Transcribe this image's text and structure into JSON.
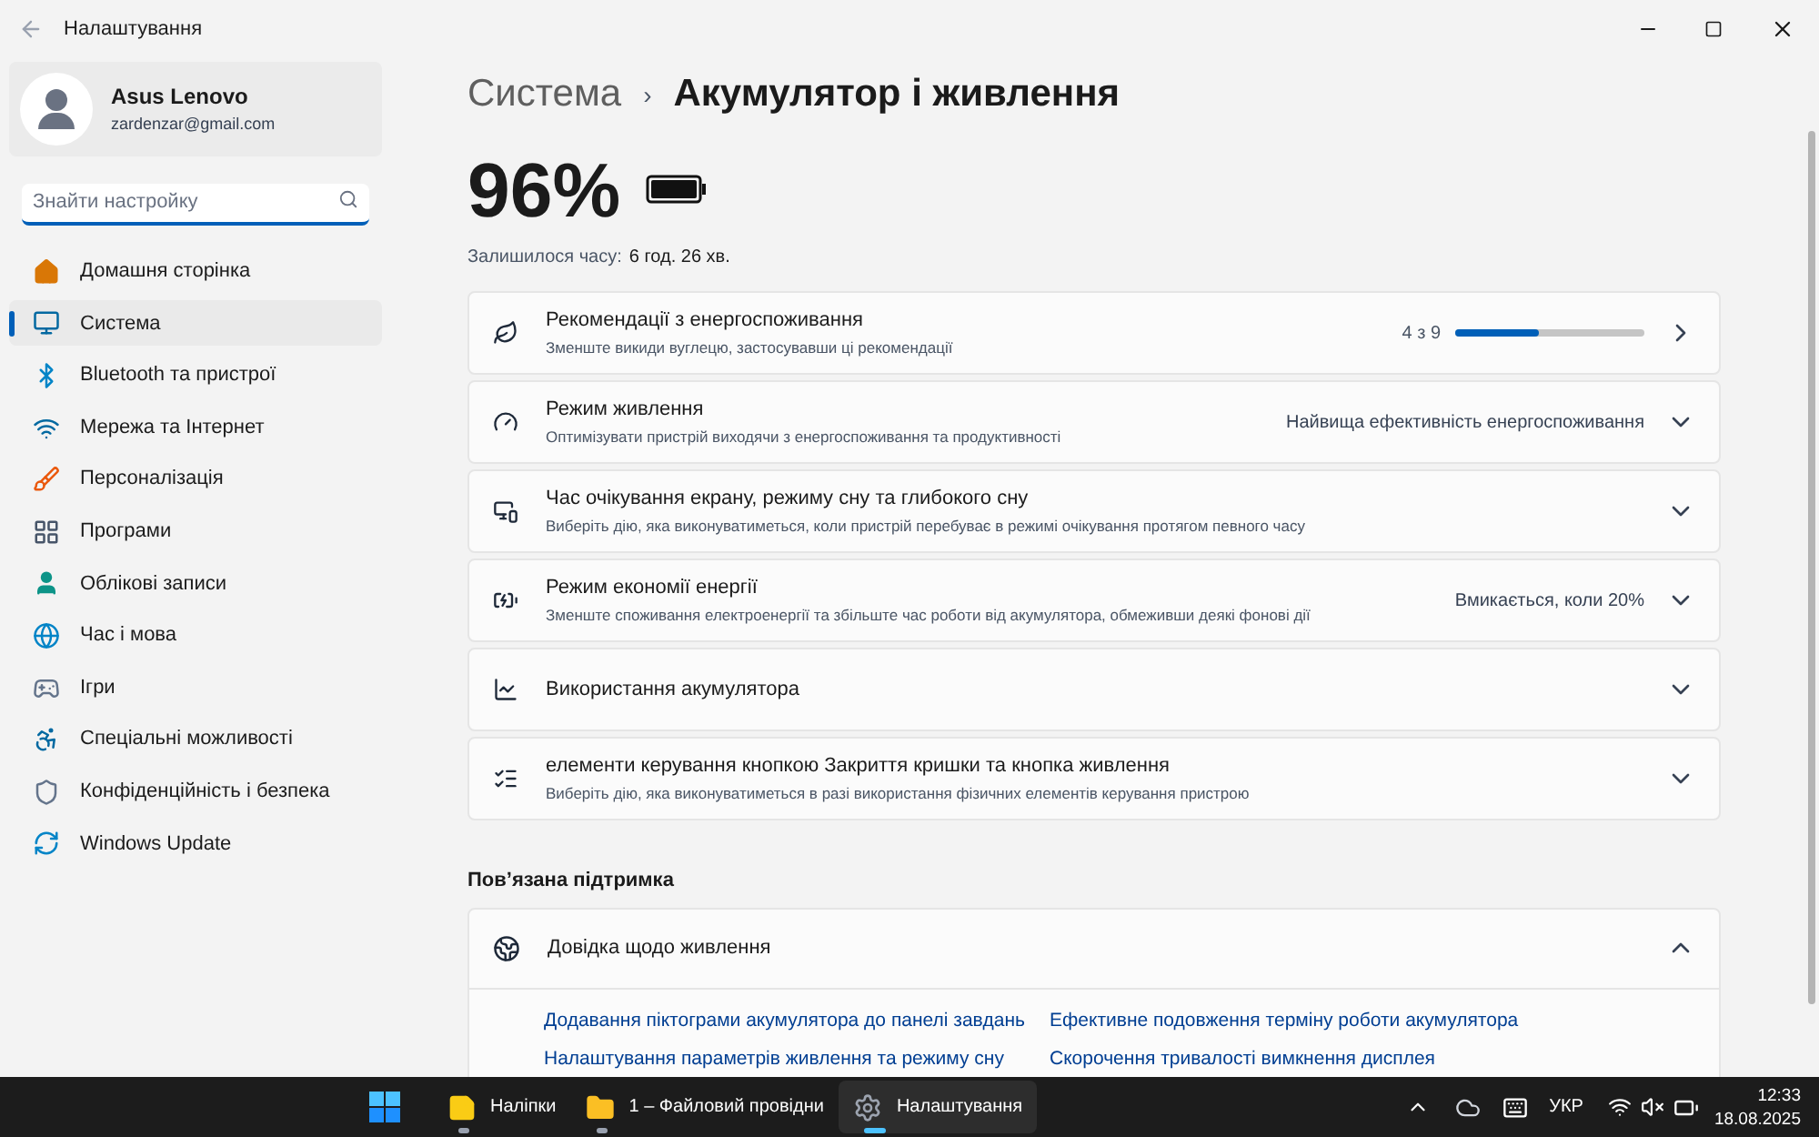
{
  "window": {
    "title": "Налаштування"
  },
  "account": {
    "name": "Asus Lenovo",
    "email": "zardenzar@gmail.com"
  },
  "search": {
    "placeholder": "Знайти настройку"
  },
  "sidebar": {
    "items": [
      {
        "label": "Домашня сторінка",
        "selected": false
      },
      {
        "label": "Система",
        "selected": true
      },
      {
        "label": "Bluetooth та пристрої",
        "selected": false
      },
      {
        "label": "Мережа та Інтернет",
        "selected": false
      },
      {
        "label": "Персоналізація",
        "selected": false
      },
      {
        "label": "Програми",
        "selected": false
      },
      {
        "label": "Облікові записи",
        "selected": false
      },
      {
        "label": "Час і мова",
        "selected": false
      },
      {
        "label": "Ігри",
        "selected": false
      },
      {
        "label": "Спеціальні можливості",
        "selected": false
      },
      {
        "label": "Конфіденційність і безпека",
        "selected": false
      },
      {
        "label": "Windows Update",
        "selected": false
      }
    ]
  },
  "breadcrumb": {
    "parent": "Система",
    "separator": "›",
    "current": "Акумулятор і живлення"
  },
  "battery": {
    "percent": "96%",
    "remaining_label": "Залишилося часу:",
    "remaining_value": "6 год. 26 хв."
  },
  "cards": [
    {
      "kind": "link",
      "title": "Рекомендації з енергоспоживання",
      "subtitle": "Зменште викиди вуглецю, застосувавши ці рекомендації",
      "progress_label": "4 з 9",
      "level": 0.44
    },
    {
      "kind": "expander",
      "expanded": false,
      "title": "Режим живлення",
      "subtitle": "Оптимізувати пристрій виходячи з енергоспоживання та продуктивності",
      "value": "Найвища ефективність енергоспоживання"
    },
    {
      "kind": "expander",
      "expanded": false,
      "title": "Час очікування екрану, режиму сну та глибокого сну",
      "subtitle": "Виберіть дію, яка виконуватиметься, коли пристрій перебуває в режимі очікування протягом певного часу"
    },
    {
      "kind": "expander",
      "expanded": false,
      "title": "Режим економії енергії",
      "subtitle": "Зменште споживання електроенергії та збільште час роботи від акумулятора, обмеживши деякі фонові дії",
      "value": "Вмикається, коли 20%"
    },
    {
      "kind": "expander",
      "expanded": false,
      "title": "Використання акумулятора"
    },
    {
      "kind": "expander",
      "expanded": false,
      "title": "елементи керування кнопкою Закриття кришки та кнопка живлення",
      "subtitle": "Виберіть дію, яка виконуватиметься в разі використання фізичних елементів керування пристрою"
    }
  ],
  "related": {
    "heading": "Пов’язана підтримка",
    "card": {
      "title": "Довідка щодо живлення",
      "expanded": true,
      "links": [
        "Додавання піктограми акумулятора до панелі завдань",
        "Ефективне подовження терміну роботи акумулятора",
        "Налаштування параметрів живлення та режиму сну",
        "Скорочення тривалості вимкнення дисплея"
      ]
    }
  },
  "taskbar": {
    "apps": [
      {
        "label": "Наліпки",
        "selected": false
      },
      {
        "label": "1 – Файловий провідни",
        "selected": false
      },
      {
        "label": "Налаштування",
        "selected": true
      }
    ],
    "language": "УКР",
    "time": "12:33",
    "date": "18.08.2025"
  }
}
